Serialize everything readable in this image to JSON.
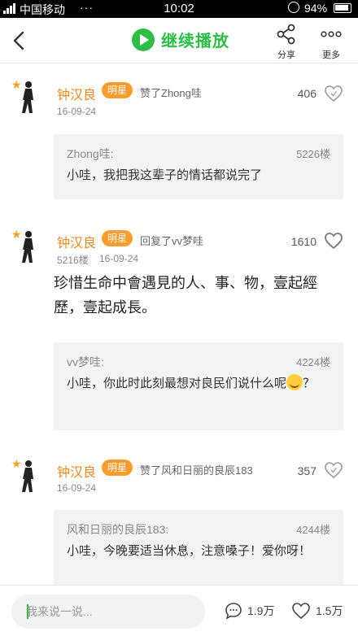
{
  "status_bar": {
    "carrier": "中国移动",
    "dots": "···",
    "time": "10:02",
    "battery": "94%"
  },
  "nav": {
    "continue_label": "继续播放",
    "share_label": "分享",
    "more_label": "更多",
    "icons": {
      "back": "chevron-left-icon",
      "play": "play-icon",
      "share": "share-icon",
      "more": "more-icon"
    },
    "accent": "#2dbe45"
  },
  "feed": {
    "items": [
      {
        "name": "钟汉良",
        "tag": "明星",
        "action": "赞了Zhong哇",
        "floor": "",
        "date": "16-09-24",
        "count": "406",
        "post": "",
        "quote": {
          "author": "Zhong哇:",
          "floor": "5226楼",
          "text": "小哇，我把我这辈子的情话都说完了"
        }
      },
      {
        "name": "钟汉良",
        "tag": "明星",
        "action": "回复了vv梦哇",
        "floor": "5216楼",
        "date": "16-09-24",
        "count": "1610",
        "post": "珍惜生命中會遇見的人、事、物，壹起經歷，壹起成長。",
        "quote": {
          "author": "vv梦哇:",
          "floor": "4224楼",
          "text": "小哇，你此时此刻最想对良民们说什么呢",
          "text_tail": "？"
        }
      },
      {
        "name": "钟汉良",
        "tag": "明星",
        "action": "赞了风和日丽的良辰183",
        "floor": "",
        "date": "16-09-24",
        "count": "357",
        "post": "",
        "quote": {
          "author": "风和日丽的良辰183:",
          "floor": "4244楼",
          "text": "小哇，今晚要适当休息，注意嗓子！爱你呀！"
        }
      }
    ],
    "name_color": "#f08a1e",
    "tag_color": "#ff9b2c"
  },
  "bottom": {
    "input_placeholder": "我来说一说...",
    "comment_count": "1.9万",
    "like_count": "1.5万"
  }
}
